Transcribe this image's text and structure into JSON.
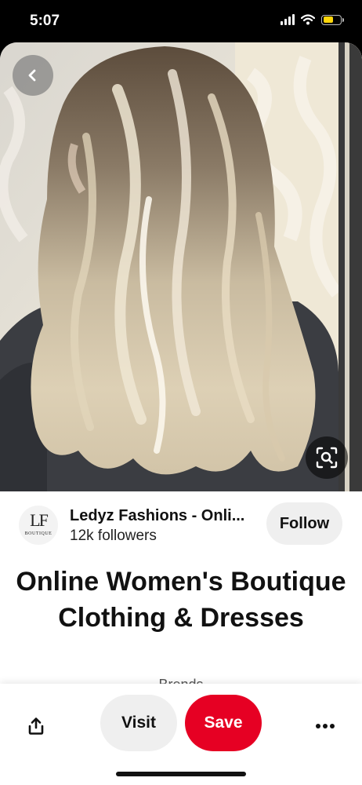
{
  "status_bar": {
    "time": "5:07",
    "icons": [
      "cellular-signal-icon",
      "wifi-icon",
      "battery-icon"
    ],
    "battery_color": "#ffd60a"
  },
  "photo": {
    "subject": "long balayage blonde wavy hair",
    "icons": [
      "back-arrow-icon",
      "visual-search-icon"
    ]
  },
  "creator": {
    "avatar_monogram": "LF",
    "avatar_subtext": "BOUTIQUE",
    "name": "Ledyz Fashions - Onli...",
    "followers": "12k followers",
    "follow_label": "Follow"
  },
  "pin": {
    "title": "Online Women's Boutique Clothing & Dresses",
    "peek_text": "Brends"
  },
  "actions": {
    "visit_label": "Visit",
    "save_label": "Save",
    "save_color": "#e60023",
    "icons": [
      "share-icon",
      "more-options-icon"
    ]
  }
}
